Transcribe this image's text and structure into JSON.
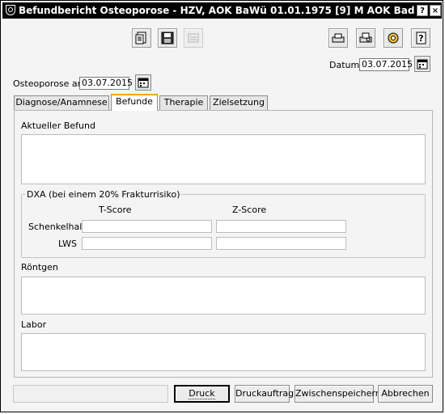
{
  "window": {
    "title": "Befundbericht Osteoporose - HZV, AOK BaWü 01.01.1975 [9] M AOK Baden-W...",
    "help_button": "?",
    "close_button": "×"
  },
  "header": {
    "datum_label": "Datum",
    "datum_value": "03.07.2015",
    "osteoporose_label": "Osteoporose am",
    "osteoporose_value": "03.07.2015"
  },
  "tabs": [
    {
      "label": "Diagnose/Anamnese",
      "active": false
    },
    {
      "label": "Befunde",
      "active": true
    },
    {
      "label": "Therapie",
      "active": false
    },
    {
      "label": "Zielsetzung",
      "active": false
    }
  ],
  "befunde": {
    "aktueller_befund_label": "Aktueller Befund",
    "dxa_group_title": "DXA (bei einem 20% Frakturrisiko)",
    "t_score_header": "T-Score",
    "z_score_header": "Z-Score",
    "row1_label": "Schenkelhals",
    "row2_label": "LWS",
    "roentgen_label": "Röntgen",
    "labor_label": "Labor"
  },
  "footer": {
    "druck": "Druck",
    "druckauftrag": "Druckauftrag",
    "zwischenspeichern": "Zwischenspeichern",
    "abbrechen": "Abbrechen"
  },
  "icons": {
    "toolbar_left": [
      "document-icon",
      "save-icon",
      "disabled-icon"
    ],
    "toolbar_right": [
      "print-icon",
      "print-preview-icon",
      "settings-icon",
      "help-icon"
    ],
    "calendar": "calendar-icon"
  }
}
